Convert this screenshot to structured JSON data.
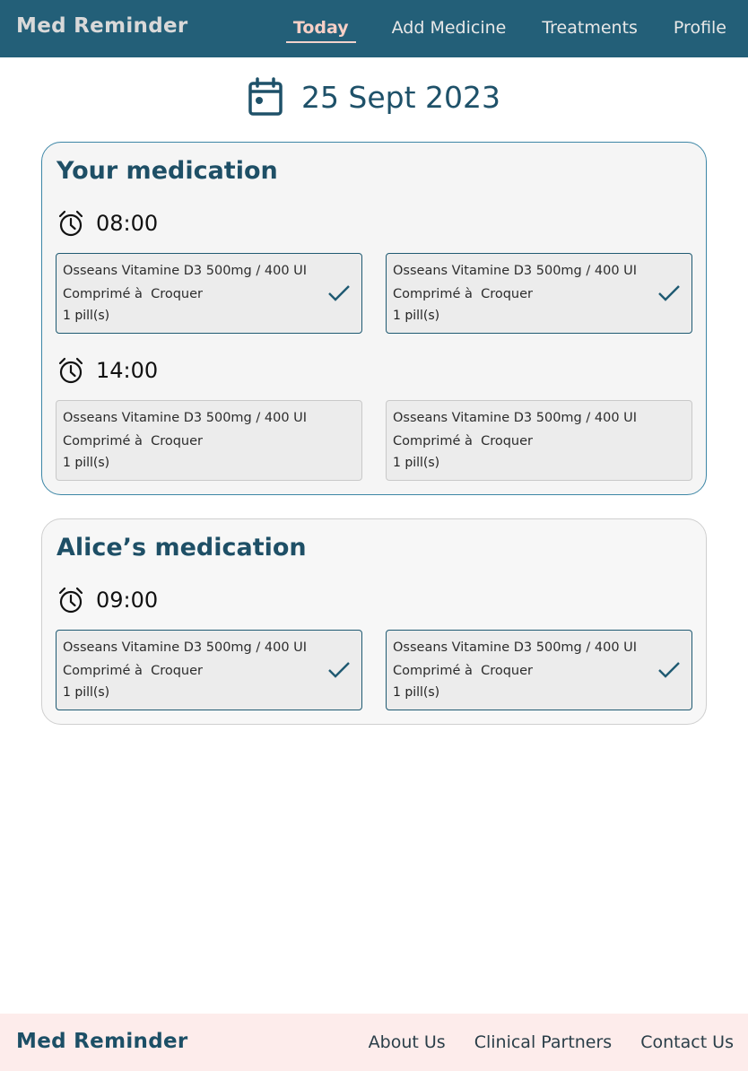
{
  "app": {
    "brand": "Med Reminder"
  },
  "nav": {
    "items": [
      {
        "label": "Today",
        "active": true
      },
      {
        "label": "Add Medicine",
        "active": false
      },
      {
        "label": "Treatments",
        "active": false
      },
      {
        "label": "Profile",
        "active": false
      }
    ]
  },
  "date": {
    "icon": "calendar-icon",
    "text": "25 Sept 2023"
  },
  "sections": [
    {
      "title": "Your medication",
      "slots": [
        {
          "time": "08:00",
          "icon": "alarm-clock-icon",
          "items": [
            {
              "name": "Osseans Vitamine D3 500mg / 400 UI",
              "form": "Comprimé à  Croquer",
              "qty": "1 pill(s)",
              "taken": true
            },
            {
              "name": "Osseans Vitamine D3 500mg / 400 UI",
              "form": "Comprimé à  Croquer",
              "qty": "1 pill(s)",
              "taken": true
            }
          ]
        },
        {
          "time": "14:00",
          "icon": "alarm-clock-icon",
          "items": [
            {
              "name": "Osseans Vitamine D3 500mg / 400 UI",
              "form": "Comprimé à  Croquer",
              "qty": "1 pill(s)",
              "taken": false
            },
            {
              "name": "Osseans Vitamine D3 500mg / 400 UI",
              "form": "Comprimé à  Croquer",
              "qty": "1 pill(s)",
              "taken": false
            }
          ]
        }
      ]
    },
    {
      "title": "Alice’s medication",
      "slots": [
        {
          "time": "09:00",
          "icon": "alarm-clock-icon",
          "items": [
            {
              "name": "Osseans Vitamine D3 500mg / 400 UI",
              "form": "Comprimé à  Croquer",
              "qty": "1 pill(s)",
              "taken": true
            },
            {
              "name": "Osseans Vitamine D3 500mg / 400 UI",
              "form": "Comprimé à  Croquer",
              "qty": "1 pill(s)",
              "taken": true
            }
          ]
        }
      ]
    }
  ],
  "footer": {
    "brand": "Med Reminder",
    "links": [
      "About Us",
      "Clinical Partners",
      "Contact Us"
    ]
  },
  "colors": {
    "header_bg": "#235f78",
    "accent": "#1e5169",
    "footer_bg": "#fdeceb",
    "nav_active": "#f7cfc6"
  }
}
